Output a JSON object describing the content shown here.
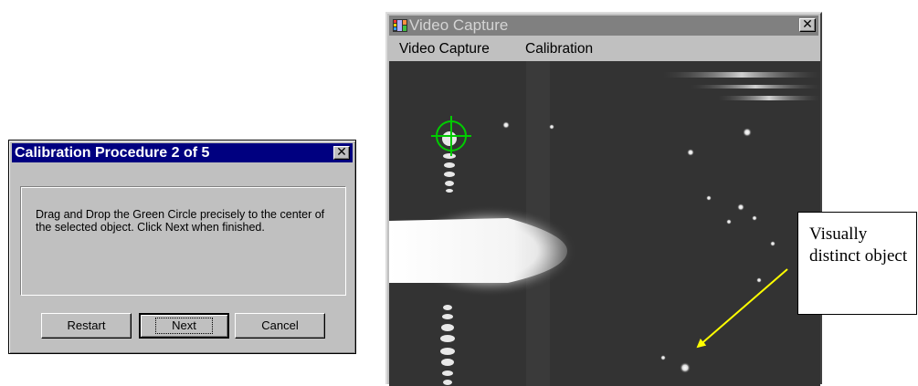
{
  "calibration_dialog": {
    "title": "Calibration Procedure 2 of 5",
    "close_glyph": "✕",
    "instruction": "Drag and Drop the Green Circle precisely to the center of the selected object. Click Next when finished.",
    "buttons": {
      "restart": "Restart",
      "next": "Next",
      "cancel": "Cancel"
    }
  },
  "video_window": {
    "title": "Video Capture",
    "close_glyph": "✕",
    "menu": [
      "Video Capture",
      "Calibration"
    ],
    "target_marker_color": "#00cc00"
  },
  "annotation": {
    "text": "Visually distinct object",
    "arrow_color": "#ffff00"
  }
}
